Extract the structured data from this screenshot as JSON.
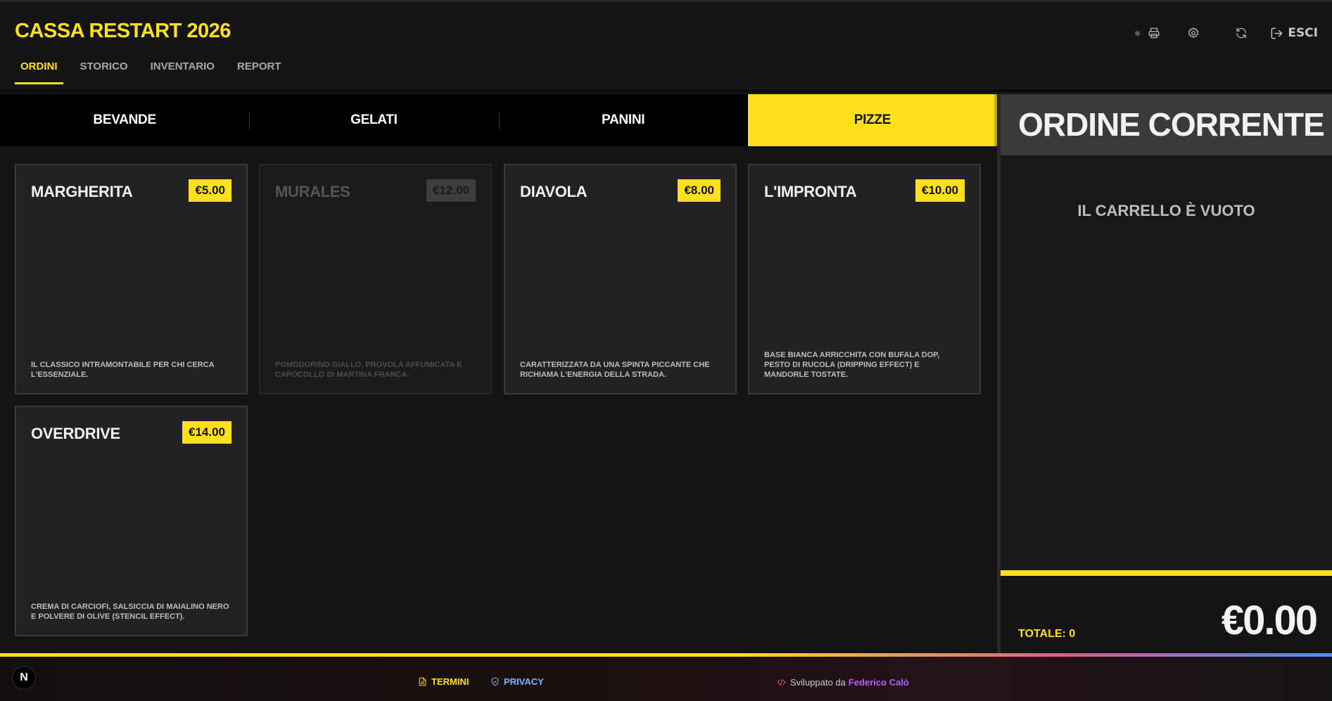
{
  "app": {
    "title": "CASSA RESTART 2026"
  },
  "nav": {
    "tabs": [
      {
        "label": "ORDINI",
        "active": true
      },
      {
        "label": "STORICO",
        "active": false
      },
      {
        "label": "INVENTARIO",
        "active": false
      },
      {
        "label": "REPORT",
        "active": false
      }
    ]
  },
  "header_actions": {
    "icons": [
      "status-dot",
      "printer-icon",
      "gear-icon",
      "refresh-icon",
      "logout-icon"
    ],
    "exit_label": "ESCI"
  },
  "categories": [
    {
      "label": "BEVANDE",
      "active": false
    },
    {
      "label": "GELATI",
      "active": false
    },
    {
      "label": "PANINI",
      "active": false
    },
    {
      "label": "PIZZE",
      "active": true
    }
  ],
  "products": [
    {
      "name": "MARGHERITA",
      "price": "€5.00",
      "description": "IL CLASSICO INTRAMONTABILE PER CHI CERCA L'ESSENZIALE.",
      "available": true
    },
    {
      "name": "MURALES",
      "price": "€12.00",
      "description": "POMODORINO GIALLO, PROVOLA AFFUMICATA E CAPOCOLLO DI MARTINA FRANCA.",
      "available": false
    },
    {
      "name": "DIAVOLA",
      "price": "€8.00",
      "description": "CARATTERIZZATA DA UNA SPINTA PICCANTE CHE RICHIAMA L'ENERGIA DELLA STRADA.",
      "available": true
    },
    {
      "name": "L'IMPRONTA",
      "price": "€10.00",
      "description": "BASE BIANCA ARRICCHITA CON BUFALA DOP, PESTO DI RUCOLA (DRIPPING EFFECT) E MANDORLE TOSTATE.",
      "available": true
    },
    {
      "name": "OVERDRIVE",
      "price": "€14.00",
      "description": "CREMA DI CARCIOFI, SALSICCIA DI MAIALINO NERO E POLVERE DI OLIVE (STENCIL EFFECT).",
      "available": true
    }
  ],
  "order": {
    "title": "ORDINE CORRENTE",
    "empty_message": "IL CARRELLO È VUOTO",
    "total_label": "TOTALE: 0",
    "total_value": "€0.00"
  },
  "footer": {
    "badge": "N",
    "terms_label": "TERMINI",
    "privacy_label": "PRIVACY",
    "credit_prefix": "Sviluppato da",
    "credit_author": "Federico Calò"
  },
  "colors": {
    "accent": "#ffe01b",
    "background": "#151515",
    "card": "#222222",
    "privacy": "#7eb4ff",
    "author": "#c05cff"
  }
}
